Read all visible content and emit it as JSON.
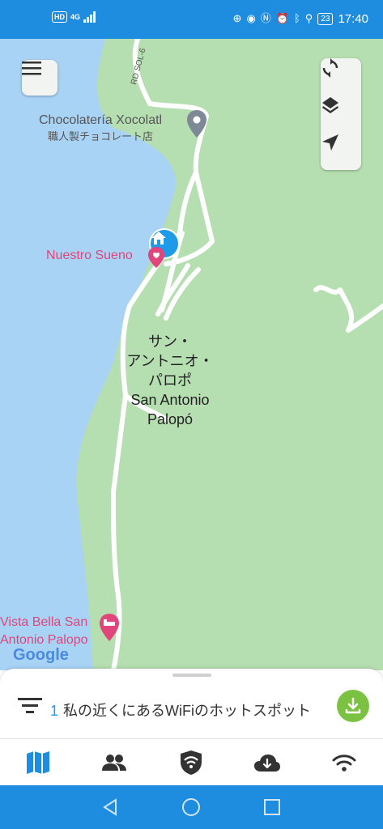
{
  "status_bar": {
    "network_badge": "HD",
    "network_type": "4G",
    "time": "17:40",
    "battery": "23"
  },
  "map": {
    "road_label": "RD SOL-6",
    "poi_chocolateria": {
      "name": "Chocolatería Xocolatl",
      "subtitle": "職人製チョコレート店"
    },
    "poi_hotel": {
      "name": "Nuestro Sueno"
    },
    "town_label": {
      "line1": "サン・",
      "line2": "アントニオ・",
      "line3": "パロポ",
      "line4": "San Antonio",
      "line5": "Palopó"
    },
    "poi_vista": {
      "line1": "Vista Bella San",
      "line2": "Antonio Palopo"
    },
    "google_logo": "Google",
    "colors": {
      "land": "#b6dfb1",
      "water": "#a9d3f5",
      "road": "#ffffff",
      "poi_red": "#e0457b",
      "hotspot_marker": "#1e9be8"
    }
  },
  "map_controls": {
    "menu_icon": "hamburger-menu-icon",
    "refresh_icon": "refresh-icon",
    "layers_icon": "layers-icon",
    "locate_icon": "navigation-arrow-icon"
  },
  "bottom_sheet": {
    "count": "1",
    "text": "私の近くにあるWiFiのホットスポット",
    "filter_icon": "filter-icon",
    "download_icon": "download-icon",
    "download_color": "#7cc242"
  },
  "tab_bar": {
    "tabs": [
      {
        "icon": "map-icon",
        "active": true
      },
      {
        "icon": "people-icon",
        "active": false
      },
      {
        "icon": "vpn-shield-icon",
        "active": false
      },
      {
        "icon": "cloud-download-icon",
        "active": false
      },
      {
        "icon": "wifi-icon",
        "active": false
      }
    ],
    "accent": "#1e8de0"
  },
  "nav_bar": {
    "buttons": [
      "back-icon",
      "home-icon",
      "recents-icon"
    ]
  }
}
